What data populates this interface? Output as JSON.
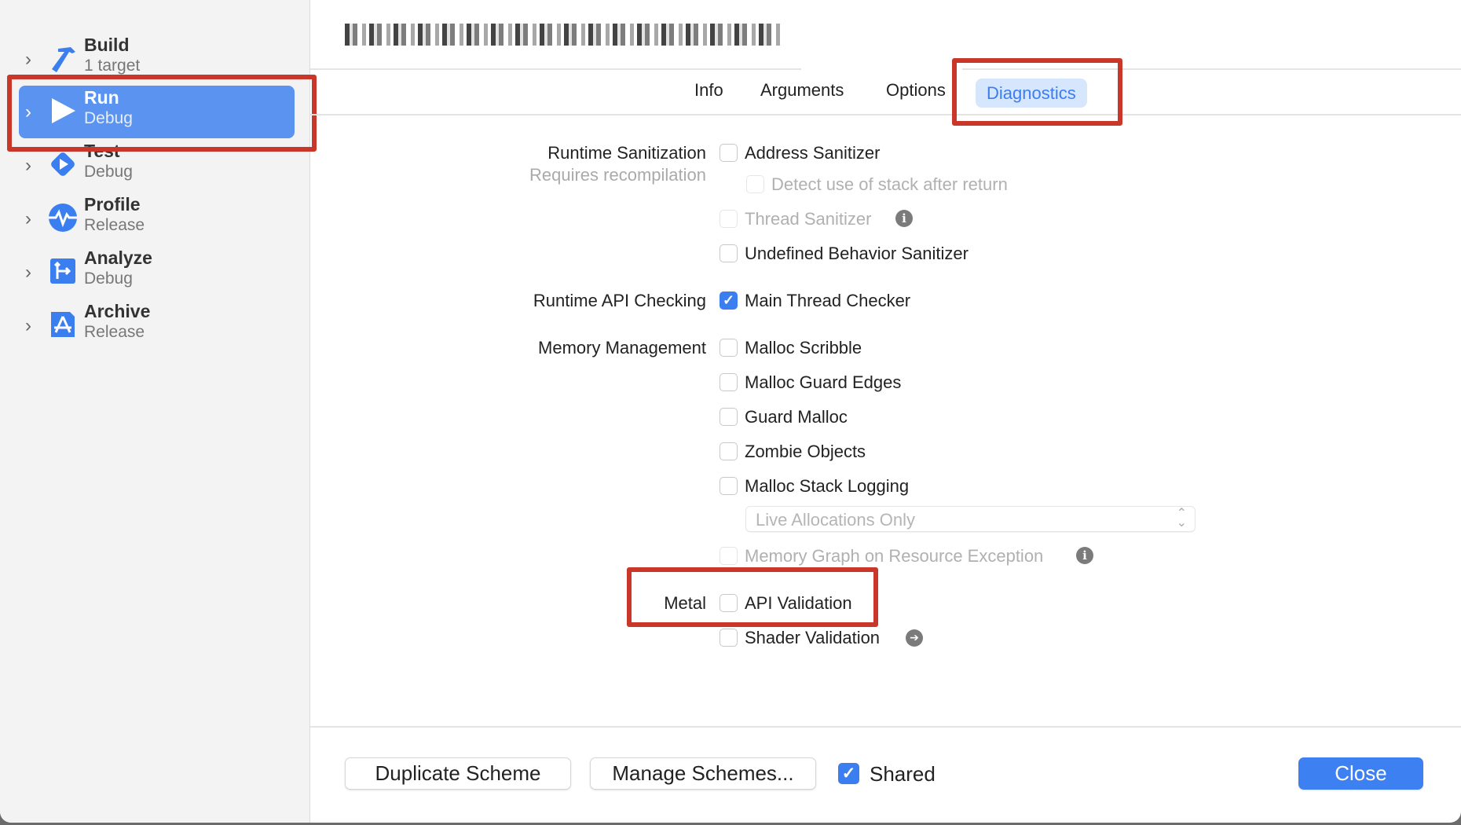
{
  "sidebar": {
    "items": [
      {
        "title": "Build",
        "subtitle": "1 target",
        "icon": "hammer-icon",
        "selected": false
      },
      {
        "title": "Run",
        "subtitle": "Debug",
        "icon": "play-icon",
        "selected": true
      },
      {
        "title": "Test",
        "subtitle": "Debug",
        "icon": "test-diamond-icon",
        "selected": false
      },
      {
        "title": "Profile",
        "subtitle": "Release",
        "icon": "waveform-icon",
        "selected": false
      },
      {
        "title": "Analyze",
        "subtitle": "Debug",
        "icon": "analyze-icon",
        "selected": false
      },
      {
        "title": "Archive",
        "subtitle": "Release",
        "icon": "archive-icon",
        "selected": false
      }
    ]
  },
  "tabs": [
    {
      "label": "Info"
    },
    {
      "label": "Arguments"
    },
    {
      "label": "Options"
    },
    {
      "label": "Diagnostics",
      "active": true
    }
  ],
  "sections": {
    "runtime_sanitization": "Runtime Sanitization",
    "requires_recompilation": "Requires recompilation",
    "runtime_api": "Runtime API Checking",
    "memory": "Memory Management",
    "metal": "Metal"
  },
  "options": {
    "address_sanitizer": {
      "label": "Address Sanitizer",
      "checked": false
    },
    "detect_stack": {
      "label": "Detect use of stack after return",
      "checked": false,
      "disabled": true
    },
    "thread_sanitizer": {
      "label": "Thread Sanitizer",
      "checked": false,
      "disabled": true
    },
    "ub_sanitizer": {
      "label": "Undefined Behavior Sanitizer",
      "checked": false
    },
    "main_thread_checker": {
      "label": "Main Thread Checker",
      "checked": true
    },
    "malloc_scribble": {
      "label": "Malloc Scribble",
      "checked": false
    },
    "malloc_guard_edges": {
      "label": "Malloc Guard Edges",
      "checked": false
    },
    "guard_malloc": {
      "label": "Guard Malloc",
      "checked": false
    },
    "zombie_objects": {
      "label": "Zombie Objects",
      "checked": false
    },
    "malloc_stack_logging": {
      "label": "Malloc Stack Logging",
      "checked": false
    },
    "malloc_stack_mode": {
      "value": "Live Allocations Only"
    },
    "memory_graph": {
      "label": "Memory Graph on Resource Exception",
      "checked": false,
      "disabled": true
    },
    "api_validation": {
      "label": "API Validation",
      "checked": false
    },
    "shader_validation": {
      "label": "Shader Validation",
      "checked": false
    }
  },
  "footer": {
    "duplicate": "Duplicate Scheme",
    "manage": "Manage Schemes...",
    "shared": "Shared",
    "shared_checked": true,
    "close": "Close"
  },
  "colors": {
    "accent": "#3d80f2",
    "selection": "#5a93f0",
    "annotation": "#c9372a"
  }
}
